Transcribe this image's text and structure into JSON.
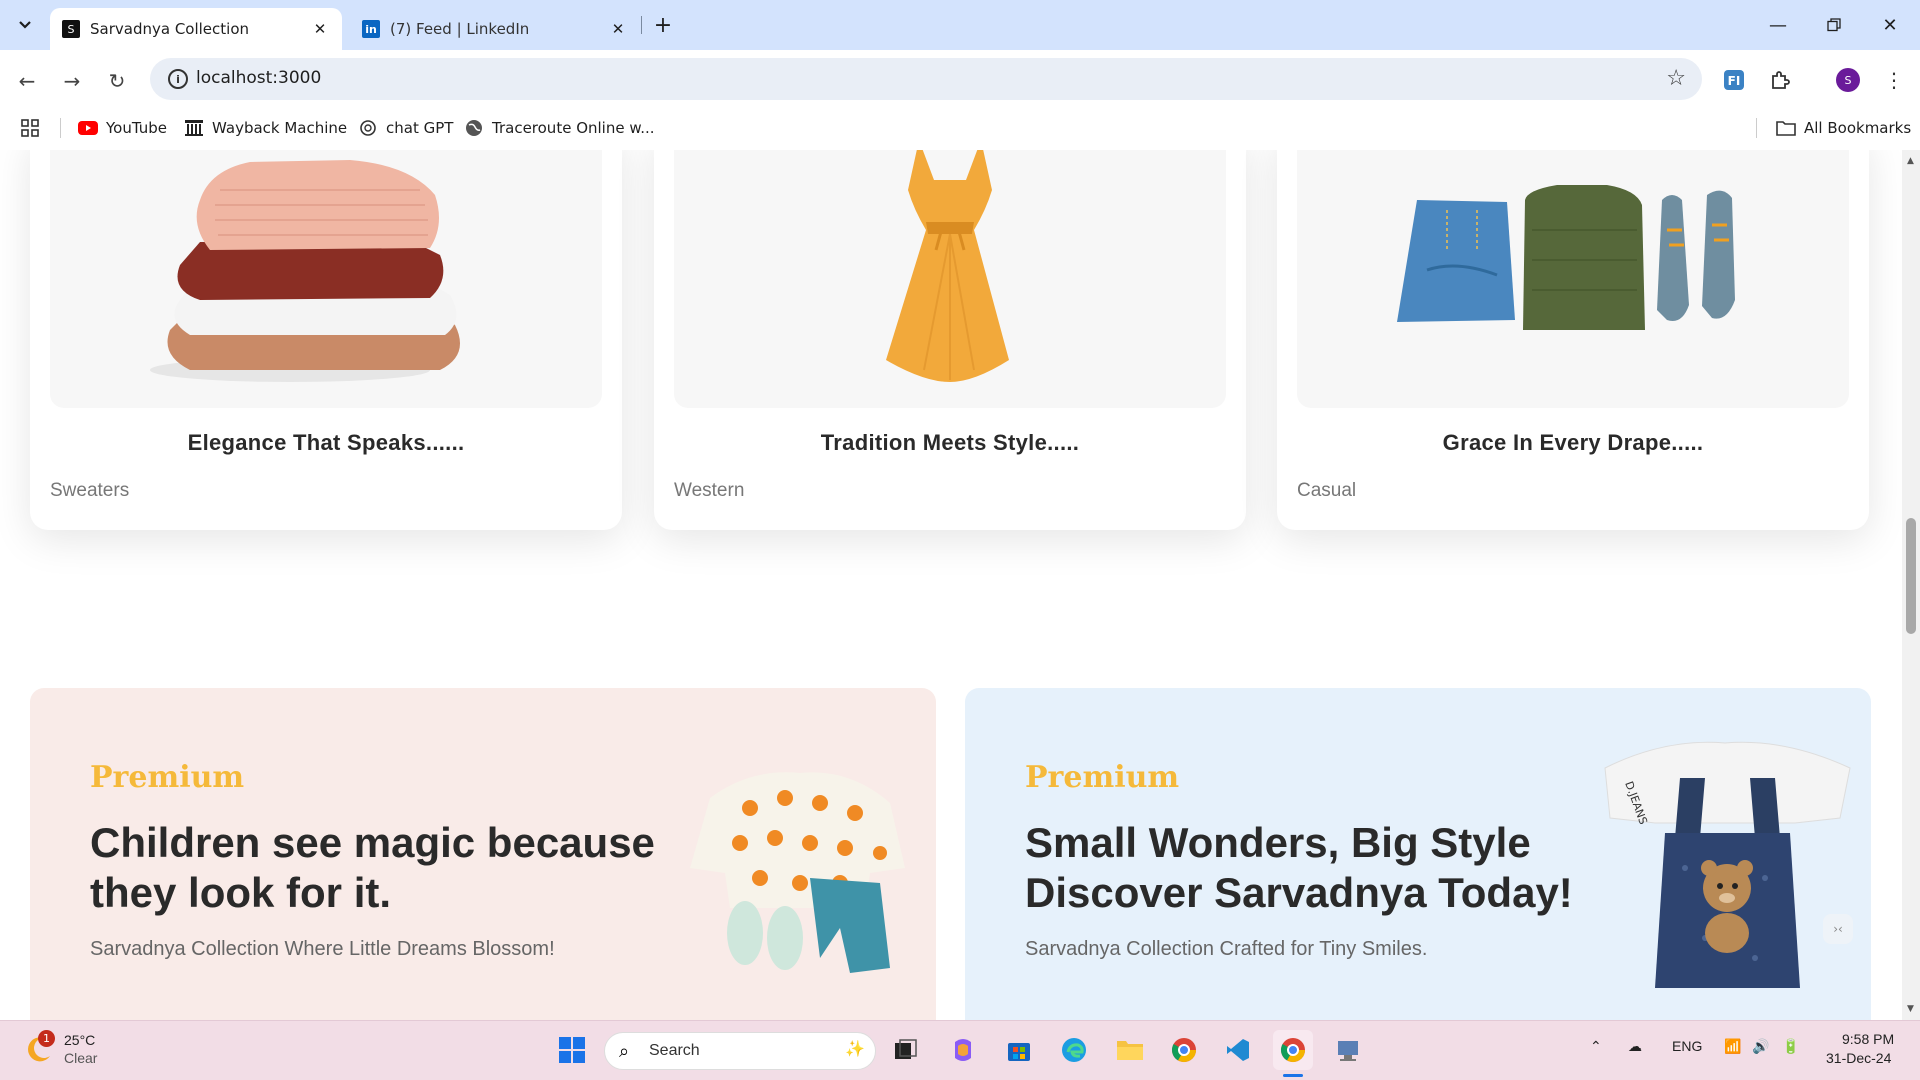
{
  "browser": {
    "tabs": [
      {
        "title": "Sarvadnya Collection",
        "active": true
      },
      {
        "title": "(7) Feed | LinkedIn",
        "active": false
      }
    ],
    "url": "localhost:3000",
    "profile_initial": "S",
    "bookmarks": [
      {
        "label": "YouTube",
        "icon": "youtube-icon"
      },
      {
        "label": "Wayback Machine",
        "icon": "wayback-icon"
      },
      {
        "label": "chat GPT",
        "icon": "chatgpt-icon"
      },
      {
        "label": "Traceroute Online w...",
        "icon": "globe-icon"
      }
    ],
    "all_bookmarks": "All Bookmarks"
  },
  "cards": [
    {
      "title": "Elegance That Speaks......",
      "category": "Sweaters",
      "image": "folded-sweaters"
    },
    {
      "title": "Tradition Meets Style.....",
      "category": "Western",
      "image": "yellow-dress"
    },
    {
      "title": "Grace In Every Drape.....",
      "category": "Casual",
      "image": "jeans-sweater-shoes"
    }
  ],
  "promos": [
    {
      "pretitle": "Premium",
      "headline_line1": "Children see magic because",
      "headline_line2": "they look for it.",
      "subtitle": "Sarvadnya Collection Where Little Dreams Blossom!",
      "bg": "#f9ebe8"
    },
    {
      "pretitle": "Premium",
      "headline_line1": "Small Wonders, Big Style",
      "headline_line2": "Discover Sarvadnya Today!",
      "subtitle": "Sarvadnya Collection Crafted for Tiny Smiles.",
      "bg": "#e6f1fb"
    }
  ],
  "taskbar": {
    "weather_temp": "25°C",
    "weather_desc": "Clear",
    "weather_badge": "1",
    "search": "Search",
    "lang": "ENG",
    "time": "9:58 PM",
    "date": "31-Dec-24"
  },
  "colors": {
    "accent_gold": "#f5b93a",
    "tabbar": "#d3e3fd",
    "taskbar": "#f2dde6"
  }
}
